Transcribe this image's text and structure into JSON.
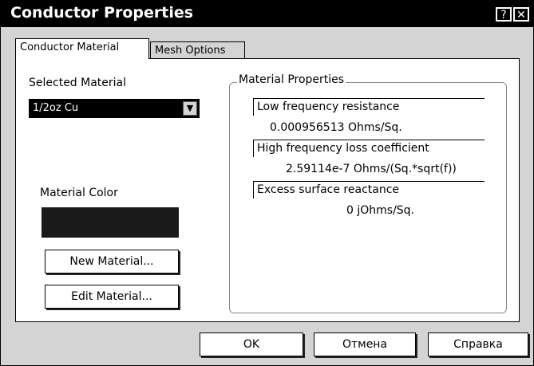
{
  "window": {
    "title": "Conductor Properties",
    "help_glyph": "?",
    "close_glyph": "✕"
  },
  "tabs": [
    {
      "label": "Conductor Material",
      "active": true
    },
    {
      "label": "Mesh Options",
      "active": false
    }
  ],
  "material": {
    "selected_label": "Selected Material",
    "selected_value": "1/2oz Cu",
    "color_label": "Material Color",
    "color_value": "#1a1a1a",
    "new_button": "New Material...",
    "edit_button": "Edit Material..."
  },
  "properties": {
    "group_title": "Material Properties",
    "items": [
      {
        "label": "Low frequency resistance",
        "value": "0.000956513  Ohms/Sq."
      },
      {
        "label": "High frequency loss coefficient",
        "value": "2.59114e-7  Ohms/(Sq.*sqrt(f))"
      },
      {
        "label": "Excess surface reactance",
        "value": "0  jOhms/Sq."
      }
    ]
  },
  "footer": {
    "ok": "OK",
    "cancel": "Отмена",
    "help": "Справка"
  }
}
